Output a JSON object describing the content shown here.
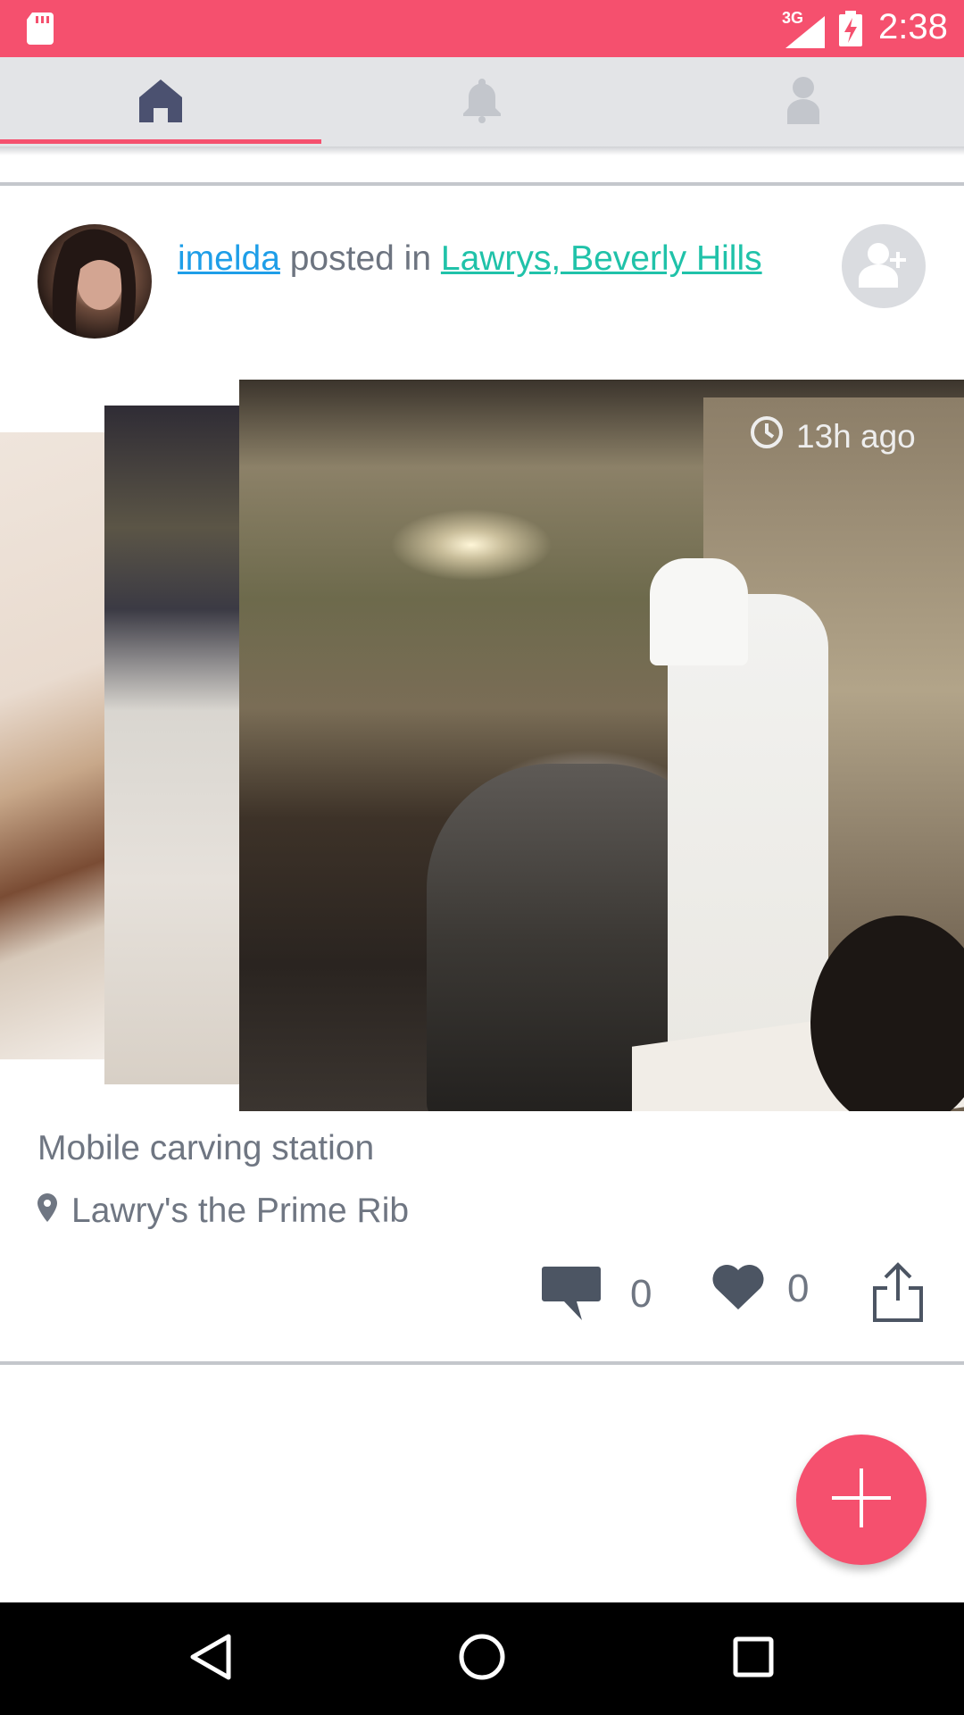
{
  "status_bar": {
    "time": "2:38",
    "network": "3G",
    "icons": [
      "sd-card-icon",
      "signal-icon",
      "battery-icon"
    ],
    "background_color": "#f5506e"
  },
  "tabs": [
    {
      "icon": "home-icon",
      "selected": true
    },
    {
      "icon": "bell-icon",
      "selected": false
    },
    {
      "icon": "profile-icon",
      "selected": false
    }
  ],
  "post": {
    "username": "imelda",
    "posted_in_text": "posted in",
    "place": "Lawrys, Beverly Hills",
    "time_ago": "13h ago",
    "caption": "Mobile carving station",
    "location": "Lawry's the Prime Rib",
    "comment_count": "0",
    "like_count": "0"
  },
  "colors": {
    "accent": "#f5506e",
    "link_user": "#1e9ee8",
    "link_place": "#20c2a9",
    "text_muted": "#6f7682"
  },
  "fab": {
    "icon": "plus-icon"
  },
  "nav": [
    "back-icon",
    "home-circle-icon",
    "recents-icon"
  ]
}
